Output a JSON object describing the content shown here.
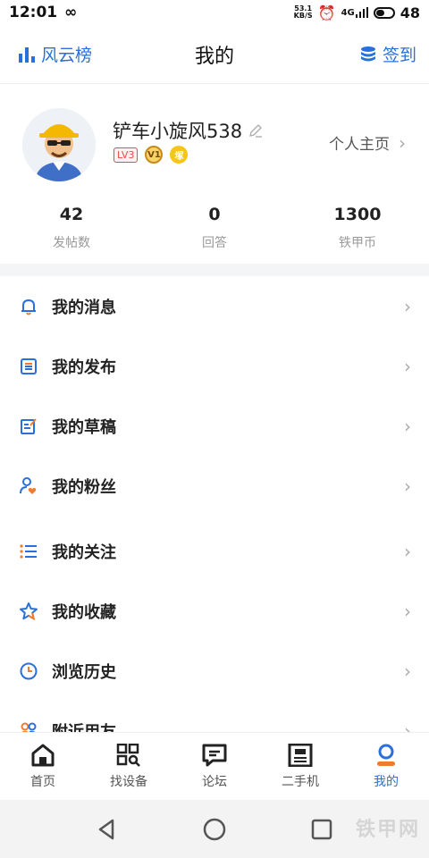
{
  "status": {
    "time": "12:01",
    "speed_top": "53.1",
    "speed_bottom": "KB/S",
    "network": "4G",
    "battery": "48"
  },
  "header": {
    "left_label": "风云榜",
    "title": "我的",
    "right_label": "签到"
  },
  "profile": {
    "username": "铲车小旋风538",
    "level": "LV3",
    "medal2": "V1",
    "medal3": "塚",
    "homepage_label": "个人主页",
    "stats": [
      {
        "value": "42",
        "label": "发帖数"
      },
      {
        "value": "0",
        "label": "回答"
      },
      {
        "value": "1300",
        "label": "铁甲币"
      }
    ]
  },
  "menu": [
    {
      "label": "我的消息",
      "icon": "bell-icon"
    },
    {
      "label": "我的发布",
      "icon": "document-icon"
    },
    {
      "label": "我的草稿",
      "icon": "edit-icon"
    },
    {
      "label": "我的粉丝",
      "icon": "fans-icon"
    },
    {
      "label": "我的关注",
      "icon": "list-icon"
    },
    {
      "label": "我的收藏",
      "icon": "star-icon"
    },
    {
      "label": "浏览历史",
      "icon": "clock-icon"
    },
    {
      "label": "附近用友",
      "icon": "people-icon"
    }
  ],
  "tabs": [
    {
      "label": "首页",
      "icon": "home-icon"
    },
    {
      "label": "找设备",
      "icon": "grid-search-icon"
    },
    {
      "label": "论坛",
      "icon": "chat-icon"
    },
    {
      "label": "二手机",
      "icon": "used-machine-icon"
    },
    {
      "label": "我的",
      "icon": "person-icon"
    }
  ],
  "colors": {
    "accent": "#2a6fdb",
    "accent_orange": "#f07b2a",
    "level_red": "#e84a4a"
  },
  "watermark": "铁甲网"
}
